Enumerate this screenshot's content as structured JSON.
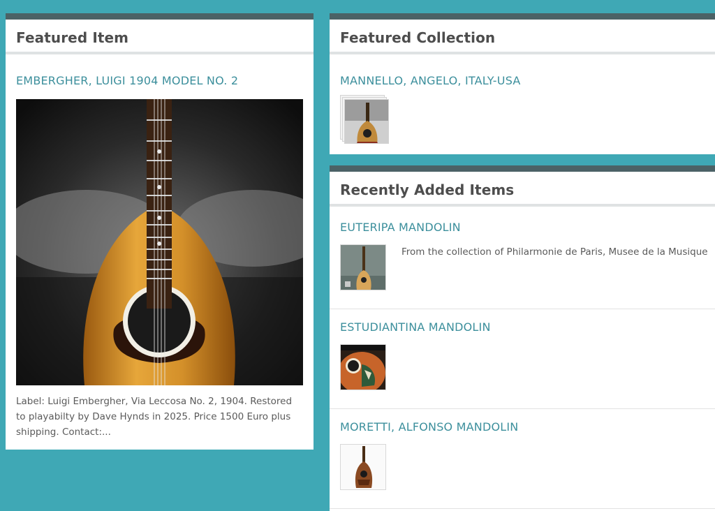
{
  "featured_item": {
    "heading": "Featured Item",
    "title": "EMBERGHER, LUIGI 1904 MODEL NO. 2",
    "description": "Label: Luigi Embergher, Via Leccosa No. 2, 1904. Restored to playabilty by Dave Hynds in 2025. Price 1500 Euro plus shipping. Contact:..."
  },
  "featured_collection": {
    "heading": "Featured Collection",
    "title": "MANNELLO, ANGELO, ITALY-USA"
  },
  "recent": {
    "heading": "Recently Added Items",
    "items": [
      {
        "title": "EUTERIPA MANDOLIN",
        "description": "From the collection of Philarmonie de Paris, Musee de la Musique"
      },
      {
        "title": "ESTUDIANTINA MANDOLIN",
        "description": ""
      },
      {
        "title": "MORETTI, ALFONSO MANDOLIN",
        "description": ""
      }
    ]
  },
  "colors": {
    "page_background": "#3fa8b5",
    "panel_top_bar": "#4b6266",
    "link": "#3c8f9c",
    "heading": "#4d4d4d"
  }
}
